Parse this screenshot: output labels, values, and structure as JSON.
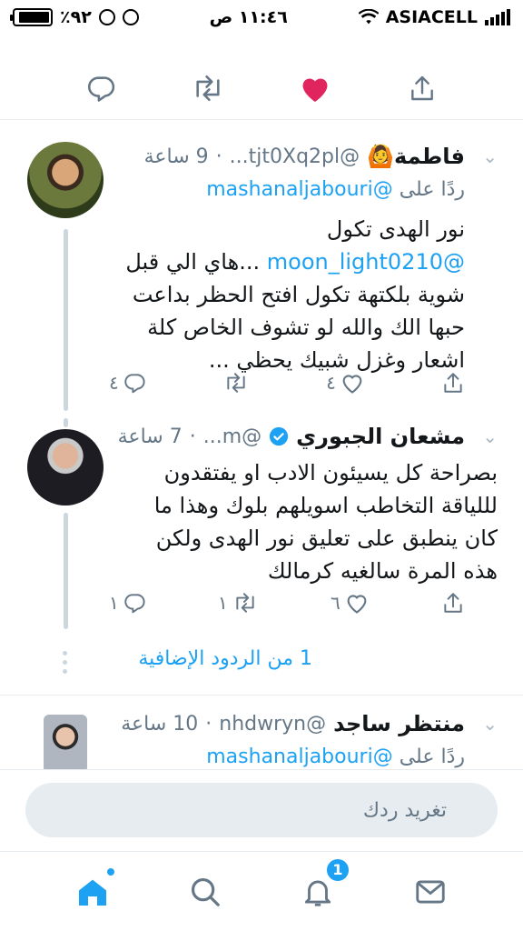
{
  "status_bar": {
    "carrier": "ASIACELL",
    "time": "١١:٤٦ ص",
    "battery": "٪٩٢",
    "battery_level": 0.92
  },
  "tweets": [
    {
      "name": "فاطمة🙆",
      "handle": "@tjt0Xq2pl...",
      "time": "9 ساعة",
      "reply_prefix": "ردًا على",
      "reply_to": "@mashanaljabouri",
      "body_line1": "نور الهدى تكول",
      "body_mention": "@moon_light0210",
      "body_rest": " ...هاي الي قبل شوية بلكتهة تكول افتح الحظر بداعت حبها الك والله لو تشوف الخاص كلة اشعار وغزل شبيك يحظي ...",
      "replies": "٤",
      "retweets": "",
      "likes": "٤"
    },
    {
      "name": "مشعان الجبوري",
      "handle": "@m...",
      "time": "7 ساعة",
      "body": "بصراحة كل  يسيئون الادب او يفتقدون لللياقة التخاطب اسويلهم بلوك وهذا ما كان ينطبق على تعليق نور الهدى ولكن هذه المرة سالغيه كرمالك",
      "replies": "١",
      "retweets": "١",
      "likes": "٦"
    },
    {
      "name": "منتظر ساجد",
      "handle": "@nhdwryn",
      "time": "10 ساعة",
      "reply_prefix": "ردًا على",
      "reply_to": "@mashanaljabouri"
    }
  ],
  "more_replies": "1 من الردود الإضافية",
  "compose_placeholder": "تغريد ردك",
  "tabbar": {
    "notifications_badge": "1"
  },
  "colors": {
    "accent": "#1da1f2",
    "like": "#e0245e",
    "muted": "#657786"
  }
}
